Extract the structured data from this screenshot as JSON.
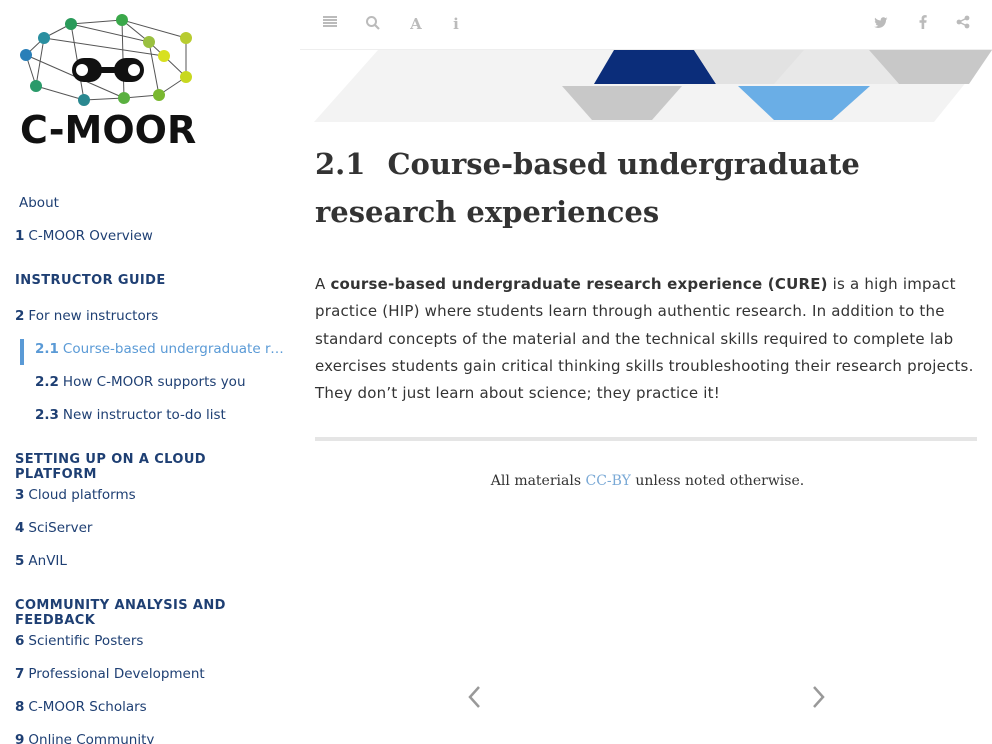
{
  "logo": {
    "text": "C-MOOR"
  },
  "sidebar": {
    "items": [
      {
        "type": "link",
        "num": "",
        "label": "About"
      },
      {
        "type": "link",
        "num": "1",
        "label": "C-MOOR Overview"
      },
      {
        "type": "header",
        "label": "INSTRUCTOR GUIDE"
      },
      {
        "type": "link",
        "num": "2",
        "label": "For new instructors"
      },
      {
        "type": "sub-active",
        "num": "2.1",
        "label": "Course-based undergraduate rese..."
      },
      {
        "type": "sub",
        "num": "2.2",
        "label": "How C-MOOR supports you"
      },
      {
        "type": "sub",
        "num": "2.3",
        "label": "New instructor to-do list"
      },
      {
        "type": "header",
        "label": "SETTING UP ON A CLOUD PLATFORM"
      },
      {
        "type": "link",
        "num": "3",
        "label": "Cloud platforms"
      },
      {
        "type": "link",
        "num": "4",
        "label": "SciServer"
      },
      {
        "type": "link",
        "num": "5",
        "label": "AnVIL"
      },
      {
        "type": "header",
        "label": "COMMUNITY ANALYSIS AND FEEDBACK"
      },
      {
        "type": "link",
        "num": "6",
        "label": "Scientific Posters"
      },
      {
        "type": "link",
        "num": "7",
        "label": "Professional Development"
      },
      {
        "type": "link",
        "num": "8",
        "label": "C-MOOR Scholars"
      },
      {
        "type": "link",
        "num": "9",
        "label": "Online Community"
      }
    ]
  },
  "toolbar": {
    "left_icons": [
      "toc-icon",
      "search-icon",
      "font-icon",
      "info-icon"
    ],
    "right_icons": [
      "twitter-icon",
      "facebook-icon",
      "share-icon"
    ]
  },
  "main": {
    "section_number": "2.1",
    "title": "Course-based undergraduate research experiences",
    "para_prefix": "A ",
    "para_bold": "course-based undergraduate research experience (CURE)",
    "para_rest": " is a high impact practice (HIP) where students learn through authentic research. In addition to the standard concepts of the material and the technical skills required to complete lab exercises students gain critical thinking skills troubleshooting their research projects. They don’t just learn about science; they practice it!",
    "footer_prefix": "All materials ",
    "footer_link": "CC-BY",
    "footer_suffix": " unless noted otherwise."
  },
  "colors": {
    "nav_text": "#1e3f73",
    "active": "#5a9ad6",
    "banner_dark": "#0b2d7a",
    "banner_light": "#6aaee6",
    "banner_gray": "#c8c8c8"
  }
}
